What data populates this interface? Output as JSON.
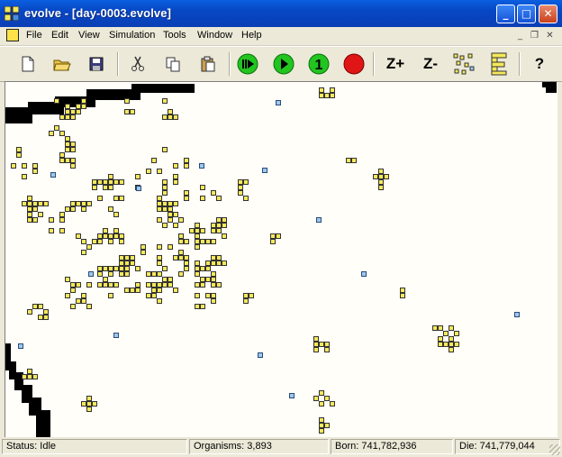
{
  "window": {
    "title": "evolve - [day-0003.evolve]",
    "minimize_glyph": "_",
    "maximize_glyph": "□",
    "close_glyph": "✕"
  },
  "menubar": {
    "items": [
      "File",
      "Edit",
      "View",
      "Simulation",
      "Tools",
      "Window",
      "Help"
    ],
    "mdi_minimize": "_",
    "mdi_restore": "❐",
    "mdi_close": "✕"
  },
  "toolbar": {
    "buttons": [
      {
        "name": "new-icon"
      },
      {
        "name": "open-folder-icon"
      },
      {
        "name": "save-icon"
      },
      {
        "name": "cut-icon"
      },
      {
        "name": "copy-icon"
      },
      {
        "name": "paste-icon"
      },
      {
        "name": "fast-forward-icon"
      },
      {
        "name": "play-icon"
      },
      {
        "name": "step-once-icon",
        "label": "1"
      },
      {
        "name": "stop-icon"
      },
      {
        "name": "zoom-in-icon",
        "label": "Z+"
      },
      {
        "name": "zoom-out-icon",
        "label": "Z-"
      },
      {
        "name": "scatter-view-icon"
      },
      {
        "name": "organism-view-icon"
      },
      {
        "name": "help-icon",
        "label": "?"
      }
    ],
    "colors": {
      "go_green": "#22c41f",
      "stop_red": "#e01515",
      "cell_yellow": "#f5e85a"
    }
  },
  "status": {
    "state": "Status: Idle",
    "organisms": "Organisms: 3,893",
    "born": "Born: 741,782,936",
    "died": "Die: 741,779,044"
  },
  "simulation_view": {
    "background": "#fffef8",
    "organism_color": "#f5e85a",
    "spore_color": "#9ec8ec",
    "barrier_color": "#000000"
  }
}
